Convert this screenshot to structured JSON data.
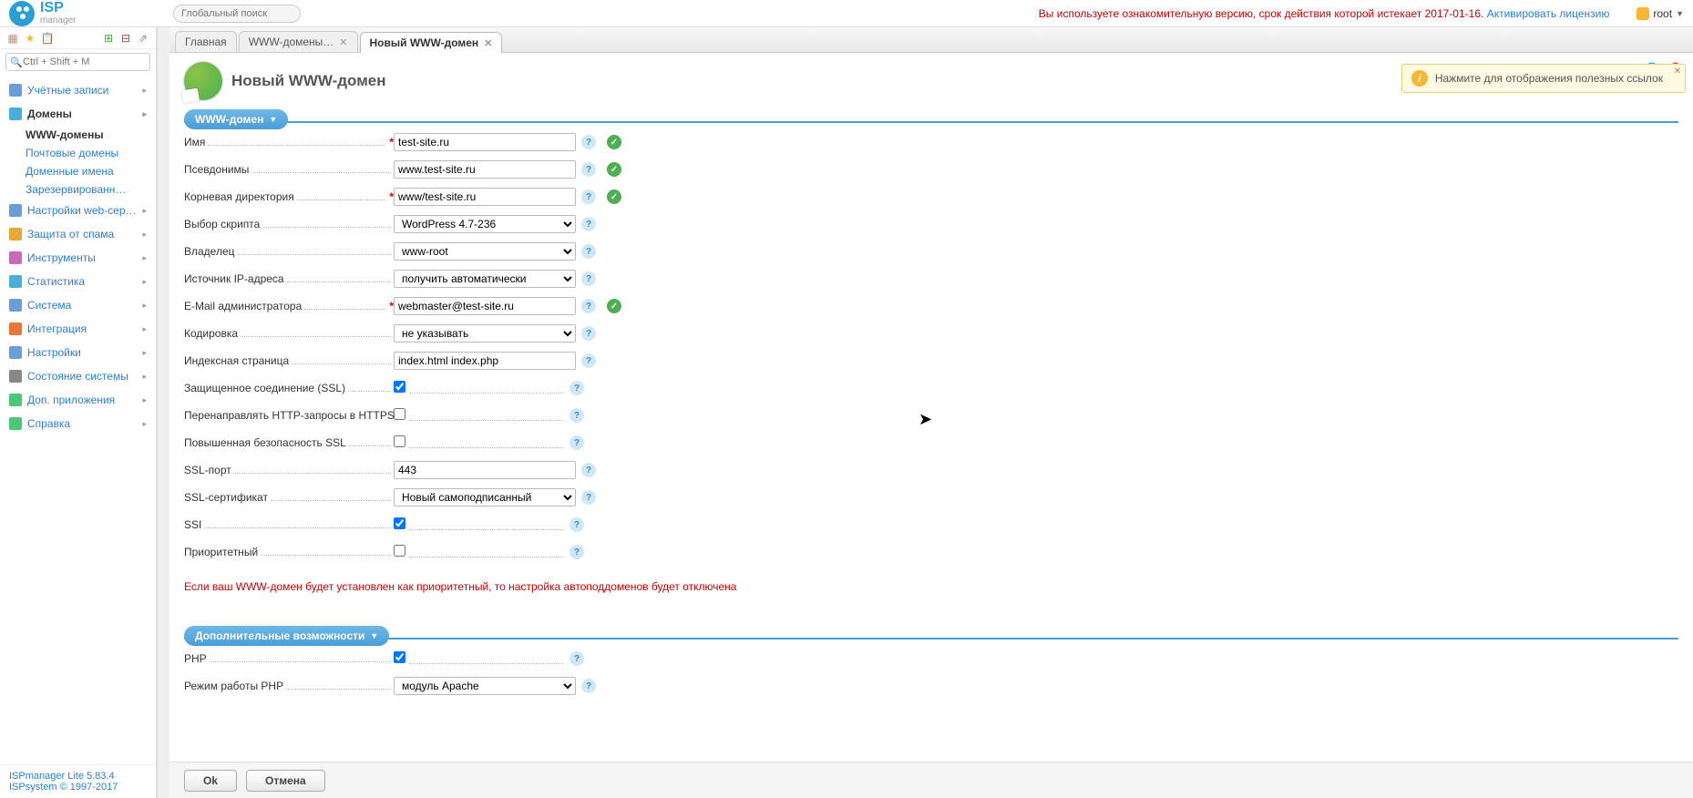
{
  "header": {
    "logo_main": "ISP",
    "logo_sub": "manager",
    "search_placeholder": "Глобальный поиск",
    "notice_red": "Вы используете ознакомительную версию, срок действия которой истекает 2017-01-16.",
    "activate_link": "Активировать лицензию",
    "username": "root"
  },
  "sidebar": {
    "filter_placeholder": "Ctrl + Shift + M",
    "items": [
      {
        "label": "Учётные записи",
        "icon_color": "#6a9ed8"
      },
      {
        "label": "Домены",
        "icon_color": "#4aaed8",
        "expanded": true,
        "subs": [
          "WWW-домены",
          "Почтовые домены",
          "Доменные имена",
          "Зарезервированн…"
        ]
      },
      {
        "label": "Настройки web-сер…",
        "icon_color": "#6a9ed8"
      },
      {
        "label": "Защита от спама",
        "icon_color": "#e8a838"
      },
      {
        "label": "Инструменты",
        "icon_color": "#c86ab8"
      },
      {
        "label": "Статистика",
        "icon_color": "#4aaed8"
      },
      {
        "label": "Система",
        "icon_color": "#6a9ed8"
      },
      {
        "label": "Интеграция",
        "icon_color": "#e87838"
      },
      {
        "label": "Настройки",
        "icon_color": "#6a9ed8"
      },
      {
        "label": "Состояние системы",
        "icon_color": "#888"
      },
      {
        "label": "Доп. приложения",
        "icon_color": "#4ac878"
      },
      {
        "label": "Справка",
        "icon_color": "#4ac878"
      }
    ],
    "footer1": "ISPmanager Lite 5.83.4",
    "footer2": "ISPsystem © 1997-2017"
  },
  "tabs": [
    {
      "label": "Главная",
      "closable": false
    },
    {
      "label": "WWW-домены…",
      "closable": true
    },
    {
      "label": "Новый WWW-домен",
      "closable": true,
      "active": true
    }
  ],
  "page": {
    "title": "Новый WWW-домен",
    "banner": "Нажмите для отображения полезных ссылок"
  },
  "section1": {
    "title": "WWW-домен"
  },
  "form": {
    "name": {
      "label": "Имя",
      "value": "test-site.ru",
      "required": true,
      "ok": true
    },
    "aliases": {
      "label": "Псевдонимы",
      "value": "www.test-site.ru",
      "ok": true
    },
    "docroot": {
      "label": "Корневая директория",
      "value": "www/test-site.ru",
      "required": true,
      "ok": true
    },
    "script": {
      "label": "Выбор скрипта",
      "value": "WordPress 4.7-236"
    },
    "owner": {
      "label": "Владелец",
      "value": "www-root"
    },
    "ipsource": {
      "label": "Источник IP-адреса",
      "value": "получить автоматически"
    },
    "email": {
      "label": "E-Mail администратора",
      "value": "webmaster@test-site.ru",
      "required": true,
      "ok": true
    },
    "charset": {
      "label": "Кодировка",
      "value": "не указывать"
    },
    "indexpage": {
      "label": "Индексная страница",
      "value": "index.html index.php"
    },
    "ssl": {
      "label": "Защищенное соединение (SSL)",
      "checked": true
    },
    "httpredirect": {
      "label": "Перенаправлять HTTP-запросы в HTTPS",
      "checked": false
    },
    "sslstrict": {
      "label": "Повышенная безопасность SSL",
      "checked": false
    },
    "sslport": {
      "label": "SSL-порт",
      "value": "443"
    },
    "sslcert": {
      "label": "SSL-сертификат",
      "value": "Новый самоподписанный"
    },
    "ssi": {
      "label": "SSI",
      "checked": true
    },
    "priority": {
      "label": "Приоритетный",
      "checked": false
    },
    "warning": "Если ваш WWW-домен будет установлен как приоритетный, то настройка автоподдоменов будет отключена"
  },
  "section2": {
    "title": "Дополнительные возможности"
  },
  "form2": {
    "php": {
      "label": "PHP",
      "checked": true
    },
    "phpmode": {
      "label": "Режим работы PHP",
      "value": "модуль Apache"
    }
  },
  "buttons": {
    "ok": "Ok",
    "cancel": "Отмена"
  }
}
